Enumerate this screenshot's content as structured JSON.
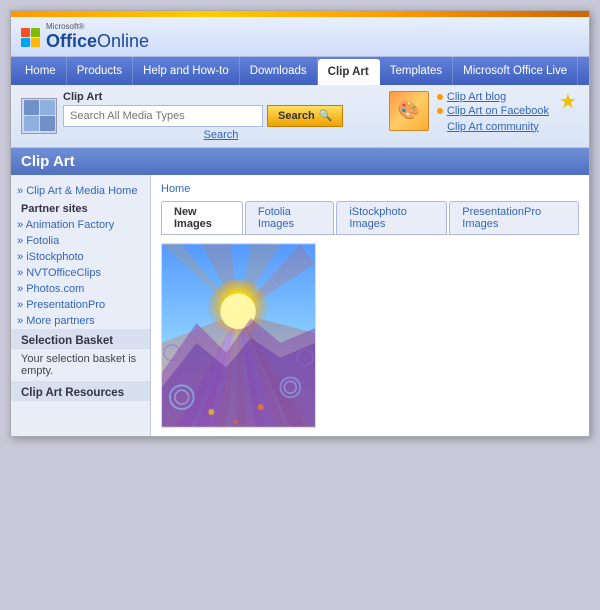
{
  "topbar": {},
  "header": {
    "microsoft_label": "Microsoft®",
    "office_label": "Office",
    "online_label": " Online"
  },
  "nav": {
    "items": [
      {
        "label": "Home",
        "id": "home",
        "active": false
      },
      {
        "label": "Products",
        "id": "products",
        "active": false
      },
      {
        "label": "Help and How-to",
        "id": "help",
        "active": false
      },
      {
        "label": "Downloads",
        "id": "downloads",
        "active": false
      },
      {
        "label": "Clip Art",
        "id": "clipart",
        "active": true
      },
      {
        "label": "Templates",
        "id": "templates",
        "active": false
      },
      {
        "label": "Microsoft Office Live",
        "id": "live",
        "active": false
      }
    ]
  },
  "search": {
    "label": "Clip Art",
    "placeholder": "Search All Media Types",
    "button_label": "Search",
    "link_label": "Search",
    "community_links": [
      {
        "label": "Clip Art blog"
      },
      {
        "label": "Clip Art on Facebook"
      }
    ],
    "community_label": "Clip Art community"
  },
  "page_title": "Clip Art",
  "breadcrumb": "Home",
  "sidebar": {
    "title": "Clip Art",
    "section_partner": "Partner sites",
    "links": [
      "» Clip Art & Media Home",
      "» Animation Factory",
      "» Fotolia",
      "» iStockphoto",
      "» NVTOfficeClips",
      "» Photos.com",
      "» PresentationPro",
      "» More partners"
    ],
    "selection_basket_title": "Selection Basket",
    "selection_basket_text": "Your selection basket is empty.",
    "resources_title": "Clip Art Resources"
  },
  "tabs": [
    {
      "label": "New Images",
      "active": true
    },
    {
      "label": "Fotolia Images",
      "active": false
    },
    {
      "label": "iStockphoto Images",
      "active": false
    },
    {
      "label": "PresentationPro Images",
      "active": false
    }
  ]
}
